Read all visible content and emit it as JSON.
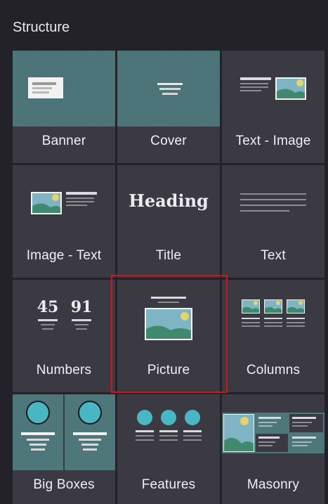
{
  "panel": {
    "title": "Structure"
  },
  "tiles": [
    {
      "label": "Banner"
    },
    {
      "label": "Cover"
    },
    {
      "label": "Text - Image"
    },
    {
      "label": "Image - Text"
    },
    {
      "label": "Title"
    },
    {
      "label": "Text"
    },
    {
      "label": "Numbers"
    },
    {
      "label": "Picture"
    },
    {
      "label": "Columns"
    },
    {
      "label": "Big Boxes"
    },
    {
      "label": "Features"
    },
    {
      "label": "Masonry"
    }
  ],
  "thumb_text": {
    "heading": "Heading",
    "num1": "45",
    "num2": "91"
  },
  "colors": {
    "selected_outline": "#d0141b",
    "tile_bg": "#3b3a43",
    "teal": "#4e777b"
  }
}
